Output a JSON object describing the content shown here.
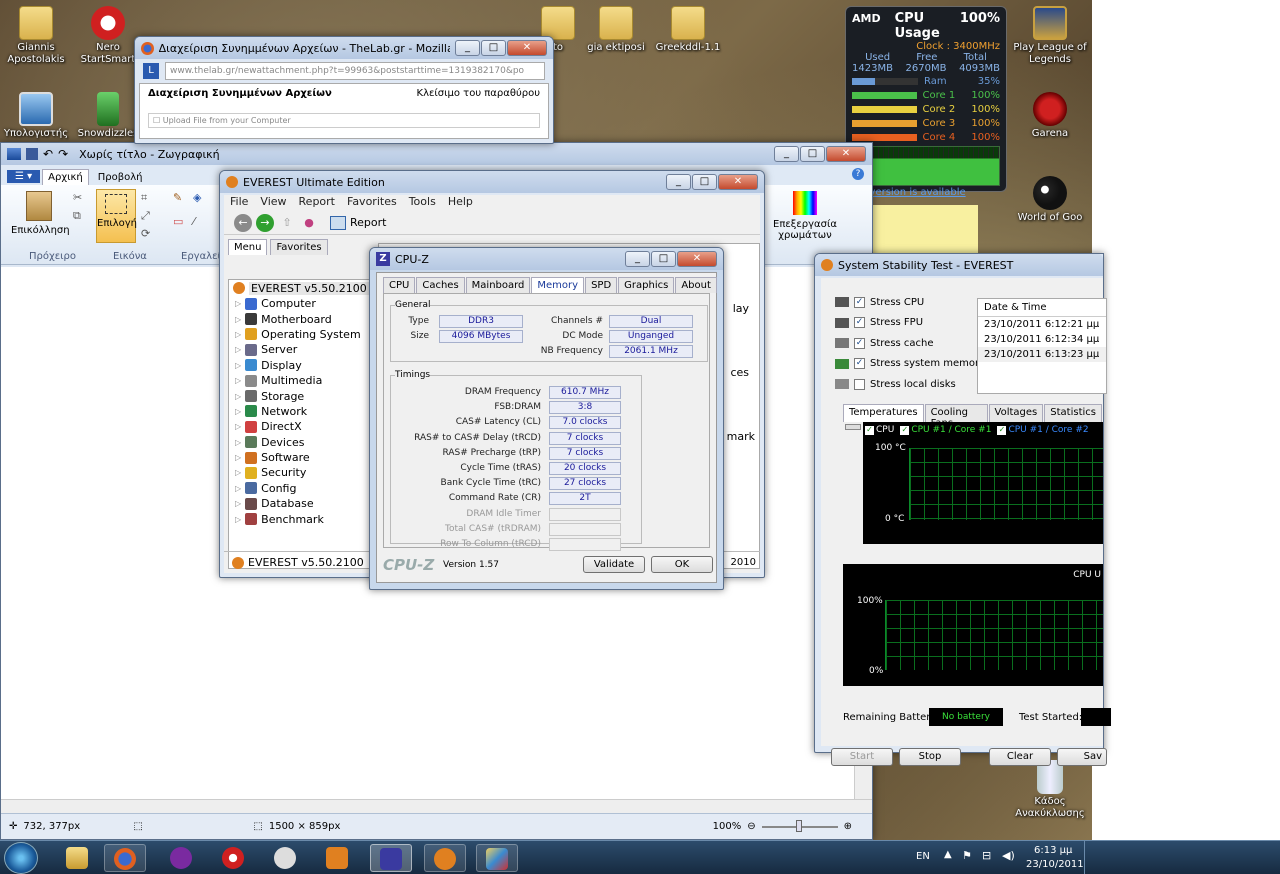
{
  "desktop": {
    "icons": [
      {
        "label": "Giannis Apostolakis"
      },
      {
        "label": "Nero StartSmart"
      },
      {
        "label": "Υπολογιστής"
      },
      {
        "label": "Snowdizzles"
      },
      {
        "label": "gia ektiposi"
      },
      {
        "label": "Greekddl-1.1"
      },
      {
        "label": "to"
      },
      {
        "label": "Play League of Legends"
      },
      {
        "label": "Garena"
      },
      {
        "label": "World of Goo"
      },
      {
        "label": "Κάδος Ανακύκλωσης"
      }
    ]
  },
  "gadget": {
    "brand": "AMD",
    "title": "CPU Usage",
    "percent": "100%",
    "clock": "Clock : 3400MHz",
    "headers": [
      "Used",
      "Free",
      "Total"
    ],
    "values": [
      "1423MB",
      "2670MB",
      "4093MB"
    ],
    "rows": [
      {
        "label": "Ram",
        "value": "35%",
        "fill": 0.35,
        "color": "#6a9ad6"
      },
      {
        "label": "Core 1",
        "value": "100%",
        "fill": 1.0,
        "color": "#4ac04a"
      },
      {
        "label": "Core 2",
        "value": "100%",
        "fill": 1.0,
        "color": "#e8d040"
      },
      {
        "label": "Core 3",
        "value": "100%",
        "fill": 1.0,
        "color": "#e8a030"
      },
      {
        "label": "Core 4",
        "value": "100%",
        "fill": 1.0,
        "color": "#e86020"
      }
    ],
    "link": "ew version is available"
  },
  "firefox": {
    "title": "Διαχείριση Συνημμένων Αρχείων - TheLab.gr - Mozilla Firefox",
    "url": "www.thelab.gr/newattachment.php?t=99963&poststarttime=1319382170&po",
    "page_heading": "Διαχείριση Συνημμένων Αρχείων",
    "close_text": "Κλείσιμο του παραθύρου",
    "upload_text": "Upload File from your Computer"
  },
  "paint": {
    "title": "Χωρίς τίτλο - Ζωγραφική",
    "tabs": [
      "Αρχική",
      "Προβολή"
    ],
    "groups": [
      "Πρόχειρο",
      "Εικόνα",
      "Εργαλεία"
    ],
    "paste": "Επικόλληση",
    "select": "Επιλογή",
    "edit_colors": "Επεξεργασία χρωμάτων",
    "status": {
      "pos": "732, 377px",
      "size": "1500 × 859px",
      "zoom": "100%"
    }
  },
  "everest": {
    "title": "EVEREST Ultimate Edition",
    "menu": [
      "File",
      "View",
      "Report",
      "Favorites",
      "Tools",
      "Help"
    ],
    "report": "Report",
    "tabs": [
      "Menu",
      "Favorites"
    ],
    "root": "EVEREST v5.50.2100",
    "tree": [
      "Computer",
      "Motherboard",
      "Operating System",
      "Server",
      "Display",
      "Multimedia",
      "Storage",
      "Network",
      "DirectX",
      "Devices",
      "Software",
      "Security",
      "Config",
      "Database",
      "Benchmark"
    ],
    "status": "EVEREST v5.50.2100",
    "status_right": "2010",
    "peek": [
      "lay",
      "ces",
      "mark"
    ]
  },
  "cpuz": {
    "title": "CPU-Z",
    "tabs": [
      "CPU",
      "Caches",
      "Mainboard",
      "Memory",
      "SPD",
      "Graphics",
      "About"
    ],
    "active_tab": "Memory",
    "general_title": "General",
    "type_label": "Type",
    "type": "DDR3",
    "size_label": "Size",
    "size": "4096 MBytes",
    "channels_label": "Channels #",
    "channels": "Dual",
    "dc_label": "DC Mode",
    "dc": "Unganged",
    "nb_label": "NB Frequency",
    "nb": "2061.1 MHz",
    "timings_title": "Timings",
    "timings": [
      {
        "label": "DRAM Frequency",
        "value": "610.7 MHz"
      },
      {
        "label": "FSB:DRAM",
        "value": "3:8"
      },
      {
        "label": "CAS# Latency (CL)",
        "value": "7.0 clocks"
      },
      {
        "label": "RAS# to CAS# Delay (tRCD)",
        "value": "7 clocks"
      },
      {
        "label": "RAS# Precharge (tRP)",
        "value": "7 clocks"
      },
      {
        "label": "Cycle Time (tRAS)",
        "value": "20 clocks"
      },
      {
        "label": "Bank Cycle Time (tRC)",
        "value": "27 clocks"
      },
      {
        "label": "Command Rate (CR)",
        "value": "2T"
      },
      {
        "label": "DRAM Idle Timer",
        "value": ""
      },
      {
        "label": "Total CAS# (tRDRAM)",
        "value": ""
      },
      {
        "label": "Row To Column (tRCD)",
        "value": ""
      }
    ],
    "logo": "CPU-Z",
    "version": "Version 1.57",
    "validate": "Validate",
    "ok": "OK"
  },
  "sst": {
    "title": "System Stability Test - EVEREST",
    "stress": [
      {
        "label": "Stress CPU",
        "checked": true
      },
      {
        "label": "Stress FPU",
        "checked": true
      },
      {
        "label": "Stress cache",
        "checked": true
      },
      {
        "label": "Stress system memory",
        "checked": true
      },
      {
        "label": "Stress local disks",
        "checked": false
      }
    ],
    "log_header": "Date & Time",
    "log": [
      "23/10/2011 6:12:21 μμ",
      "23/10/2011 6:12:34 μμ",
      "23/10/2011 6:13:23 μμ"
    ],
    "tabs": [
      "Temperatures",
      "Cooling Fans",
      "Voltages",
      "Statistics"
    ],
    "legend": [
      "CPU",
      "CPU #1 / Core #1",
      "CPU #1 / Core #2"
    ],
    "temp_top": "100 °C",
    "temp_bottom": "0 °C",
    "usage_top": "100%",
    "usage_bottom": "0%",
    "usage_label": "CPU U",
    "battery_label": "Remaining Battery:",
    "battery": "No battery",
    "started_label": "Test Started:",
    "buttons": [
      "Start",
      "Stop",
      "Clear",
      "Sav"
    ]
  },
  "taskbar": {
    "lang": "EN",
    "time": "6:13 μμ",
    "date": "23/10/2011"
  }
}
